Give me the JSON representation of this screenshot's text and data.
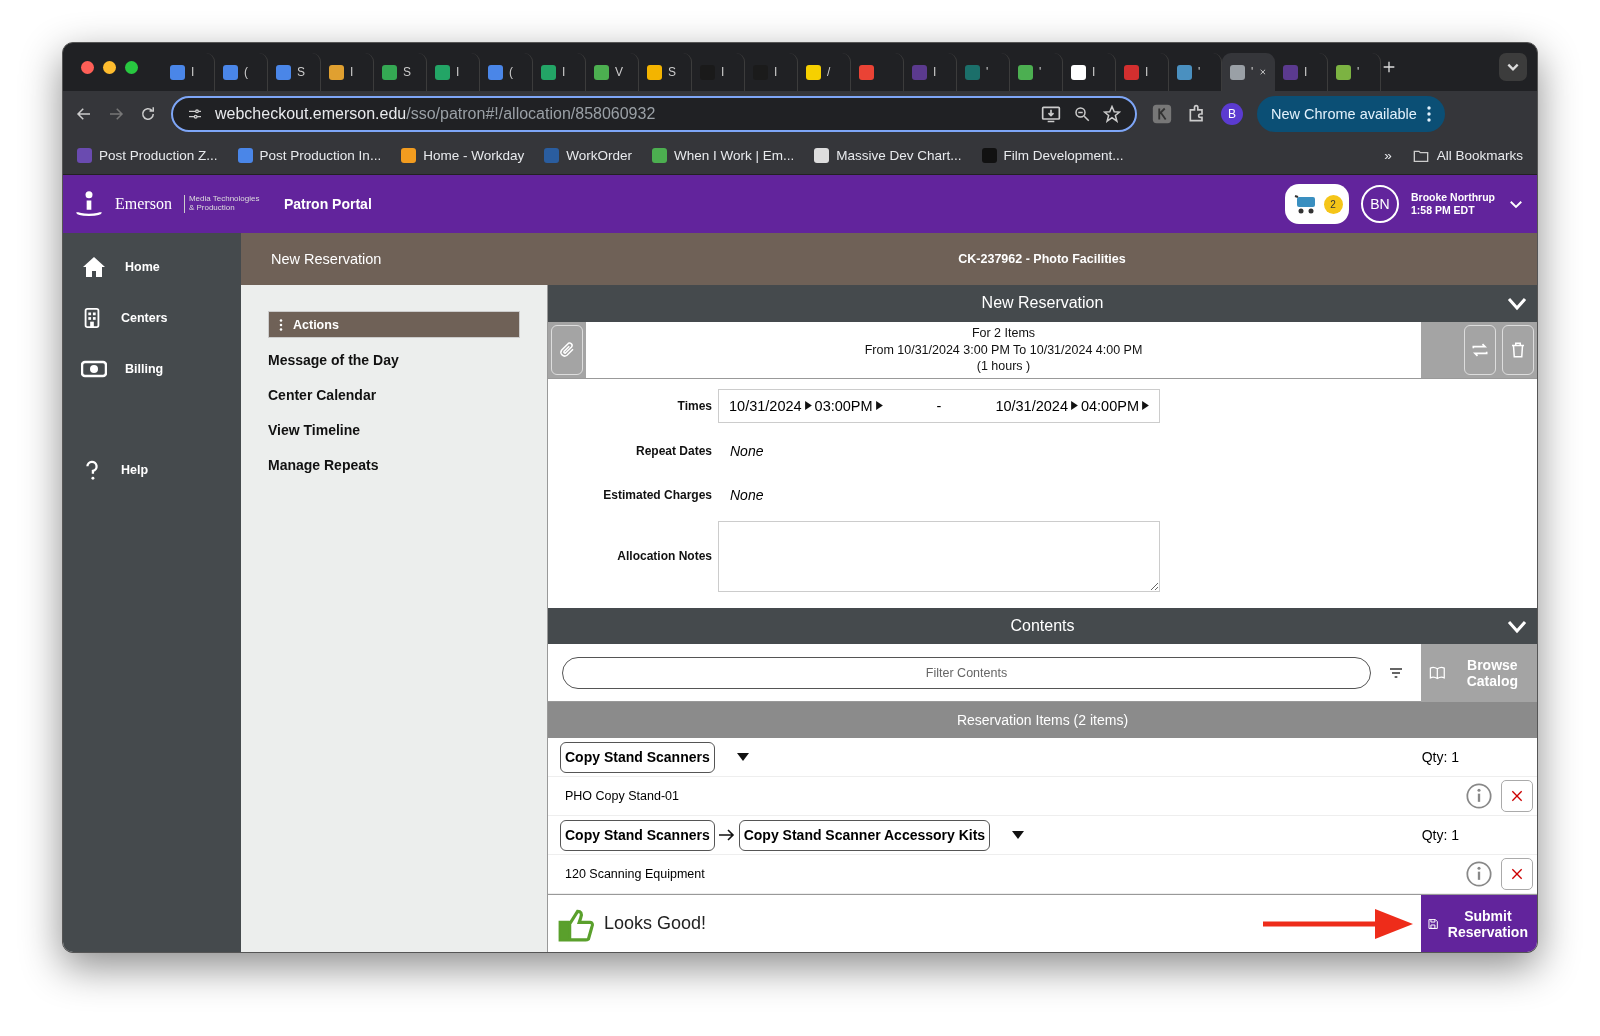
{
  "browser": {
    "tabs": [
      {
        "text": "I",
        "color": "#4a86e8",
        "selected": false
      },
      {
        "text": "(",
        "color": "#4a86e8",
        "selected": false
      },
      {
        "text": "S",
        "color": "#4a86e8",
        "selected": false
      },
      {
        "text": "I",
        "color": "#e0a030",
        "selected": false
      },
      {
        "text": "S",
        "color": "#34a853",
        "selected": false
      },
      {
        "text": "I",
        "color": "#23a566",
        "selected": false
      },
      {
        "text": "(",
        "color": "#4a86e8",
        "selected": false
      },
      {
        "text": "I",
        "color": "#23a566",
        "selected": false
      },
      {
        "text": "V",
        "color": "#4caf50",
        "selected": false
      },
      {
        "text": "S",
        "color": "#f4b400",
        "selected": false
      },
      {
        "text": "I",
        "color": "#1a1a1a",
        "selected": false
      },
      {
        "text": "I",
        "color": "#1b1b1b",
        "selected": false
      },
      {
        "text": "/",
        "color": "#f6d000",
        "selected": false
      },
      {
        "color": "#ea4335",
        "selected": false
      },
      {
        "text": "I",
        "color": "#5b3a8e",
        "selected": false
      },
      {
        "text": "'",
        "color": "#1b6f6a",
        "selected": false
      },
      {
        "text": "'",
        "color": "#4caf51",
        "selected": false
      },
      {
        "text": "I",
        "color": "#ffffff",
        "selected": false
      },
      {
        "text": "I",
        "color": "#d32f2f",
        "selected": false
      },
      {
        "text": "'",
        "color": "#4a90c0",
        "selected": false
      },
      {
        "text": "'",
        "color": "#9aa0a6",
        "selected": true
      },
      {
        "text": "I",
        "color": "#5b3a8f",
        "selected": false
      },
      {
        "text": "'",
        "color": "#7cb342",
        "selected": false
      }
    ],
    "url_host": "webcheckout.emerson.edu",
    "url_path": "/sso/patron#!/allocation/858060932",
    "profile": "B",
    "update_button": "New Chrome available",
    "bookmarks": [
      {
        "label": "Post Production Z...",
        "color": "#6a4bb0"
      },
      {
        "label": "Post Production In...",
        "color": "#4a86e8"
      },
      {
        "label": "Home - Workday",
        "color": "#f29c1f"
      },
      {
        "label": "WorkOrder",
        "color": "#2a5d9f"
      },
      {
        "label": "When I Work | Em...",
        "color": "#4caf50"
      },
      {
        "label": "Massive Dev Chart...",
        "color": "#dddddd"
      },
      {
        "label": "Film Development...",
        "color": "#111111"
      }
    ],
    "more_bookmarks": "»",
    "all_bookmarks": "All Bookmarks"
  },
  "app_header": {
    "logo": "Emerson",
    "logo_sub": "Media Technologies & Production",
    "title": "Patron Portal",
    "cart_count": "2",
    "avatar": "BN",
    "user_name": "Brooke Northrup",
    "time": "1:58 PM EDT"
  },
  "sidebar": [
    {
      "kind": "home",
      "label": "Home"
    },
    {
      "kind": "centers",
      "label": "Centers"
    },
    {
      "kind": "billing",
      "label": "Billing"
    },
    {
      "kind": "help",
      "label": "Help"
    }
  ],
  "page_bar": {
    "title": "New Reservation",
    "record": "CK-237962 - Photo Facilities"
  },
  "actions": {
    "header": "Actions",
    "items": [
      "Message of the Day",
      "Center Calendar",
      "View Timeline",
      "Manage Repeats"
    ]
  },
  "reservation": {
    "header": "New Reservation",
    "summary": [
      "For 2 Items",
      "From 10/31/2024 3:00 PM To 10/31/2024 4:00 PM",
      "(1 hours )"
    ],
    "times_label": "Times",
    "start_date": "10/31/2024",
    "start_time": "03:00PM",
    "dash": "-",
    "end_date": "10/31/2024",
    "end_time": "04:00PM",
    "repeat_label": "Repeat Dates",
    "repeat_value": "None",
    "charges_label": "Estimated Charges",
    "charges_value": "None",
    "notes_label": "Allocation Notes"
  },
  "contents": {
    "header": "Contents",
    "filter_placeholder": "Filter Contents",
    "browse_button": "Browse Catalog",
    "items_header": "Reservation Items (2 items)",
    "items": [
      {
        "path": [
          "Copy Stand Scanners"
        ],
        "qty": "Qty: 1",
        "equipment": "PHO Copy Stand-01"
      },
      {
        "path": [
          "Copy Stand Scanners",
          "Copy Stand Scanner Accessory Kits"
        ],
        "qty": "Qty: 1",
        "equipment": "120 Scanning Equipment"
      }
    ]
  },
  "footer": {
    "status": "Looks Good!",
    "submit_button": "Submit Reservation"
  }
}
